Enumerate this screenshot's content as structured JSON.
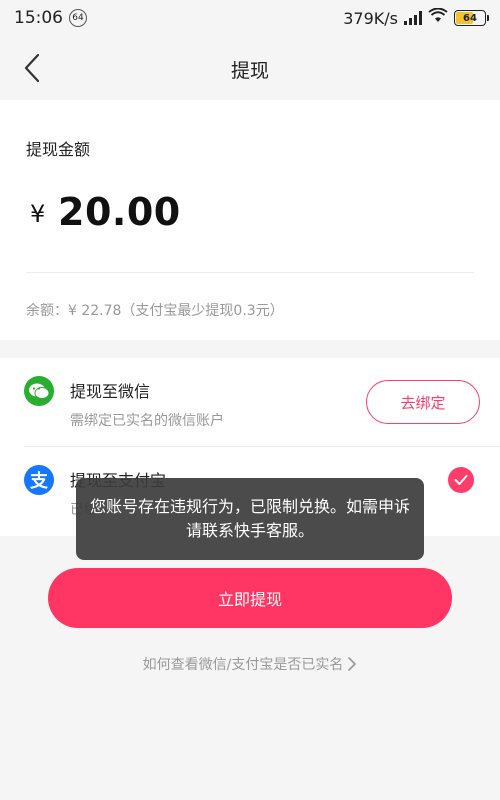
{
  "status_bar": {
    "time": "15:06",
    "notification_badge": "64",
    "network_speed": "379K/s",
    "battery": "64",
    "battery_level": 0.64
  },
  "nav": {
    "title": "提现"
  },
  "amount_card": {
    "label": "提现金额",
    "currency": "¥",
    "amount": "20.00",
    "balance": "余额：¥ 22.78（支付宝最少提现0.3元）"
  },
  "methods": {
    "wechat": {
      "title": "提现至微信",
      "subtitle": "需绑定已实名的微信账户",
      "bind_label": "去绑定"
    },
    "alipay": {
      "title": "提现至支付宝",
      "subtitle": "已绑"
    }
  },
  "toast": {
    "message": "您账号存在违规行为，已限制兑换。如需申诉请联系快手客服。"
  },
  "submit": {
    "label": "立即提现"
  },
  "help": {
    "label": "如何查看微信/支付宝是否已实名"
  },
  "colors": {
    "accent": "#ff3563",
    "wechat_green": "#2aae2f",
    "alipay_blue": "#1677ff"
  }
}
